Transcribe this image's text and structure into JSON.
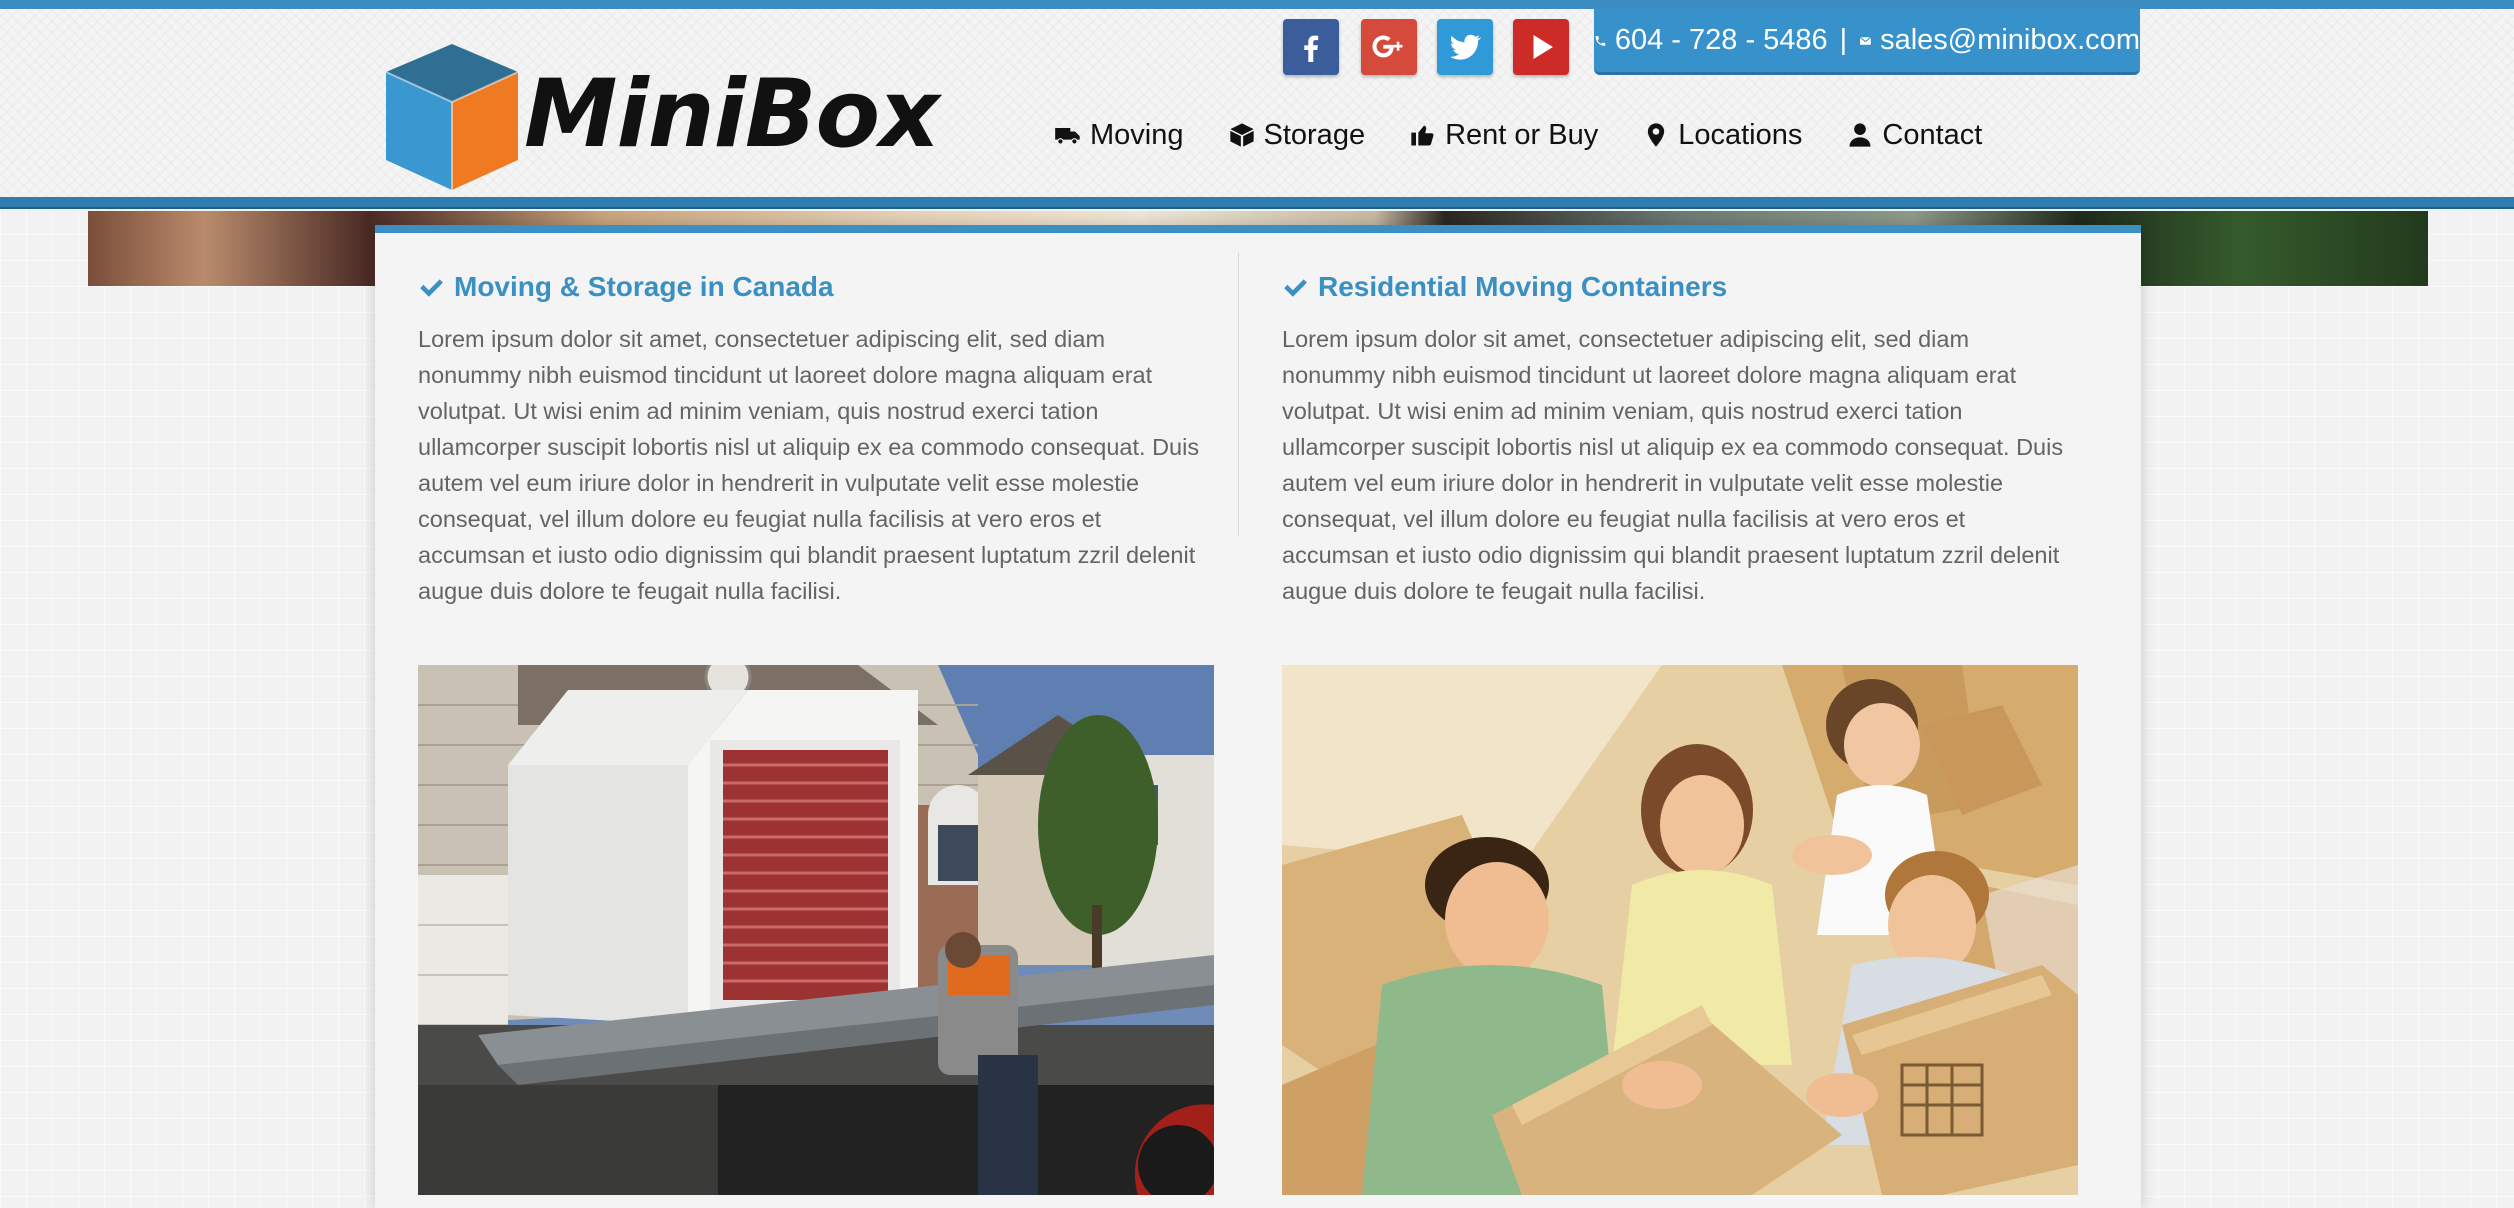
{
  "brand": {
    "name": "MiniBox"
  },
  "social": [
    {
      "name": "facebook-icon"
    },
    {
      "name": "google-plus-icon"
    },
    {
      "name": "twitter-icon"
    },
    {
      "name": "youtube-icon"
    }
  ],
  "contact": {
    "phone": "604 - 728 - 5486",
    "separator": "|",
    "email": "sales@minibox.com"
  },
  "nav": {
    "items": [
      {
        "label": "Moving",
        "icon": "truck-icon"
      },
      {
        "label": "Storage",
        "icon": "cube-icon"
      },
      {
        "label": "Rent or Buy",
        "icon": "thumbs-up-icon"
      },
      {
        "label": "Locations",
        "icon": "map-marker-icon"
      },
      {
        "label": "Contact",
        "icon": "user-icon"
      }
    ]
  },
  "sections": [
    {
      "title": "Moving & Storage in Canada",
      "body": "Lorem ipsum dolor sit amet, consectetuer adipiscing elit, sed diam nonummy nibh euismod tincidunt ut laoreet dolore magna aliquam erat volutpat. Ut wisi enim ad minim veniam, quis nostrud exerci tation ullamcorper suscipit lobortis nisl ut aliquip ex ea commodo consequat. Duis autem vel eum iriure dolor in hendrerit in vulputate velit esse molestie consequat, vel illum dolore eu feugiat nulla facilisis at vero eros et accumsan et iusto odio dignissim qui blandit praesent luptatum zzril delenit augue duis dolore te feugait nulla facilisi."
    },
    {
      "title": "Residential Moving Containers",
      "body": "Lorem ipsum dolor sit amet, consectetuer adipiscing elit, sed diam nonummy nibh euismod tincidunt ut laoreet dolore magna aliquam erat volutpat. Ut wisi enim ad minim veniam, quis nostrud exerci tation ullamcorper suscipit lobortis nisl ut aliquip ex ea commodo consequat. Duis autem vel eum iriure dolor in hendrerit in vulputate velit esse molestie consequat, vel illum dolore eu feugiat nulla facilisis at vero eros et accumsan et iusto odio dignissim qui blandit praesent luptatum zzril delenit augue duis dolore te feugait nulla facilisi."
    }
  ],
  "colors": {
    "accent": "#3b8fc2",
    "header_line": "#2d7eae",
    "text": "#646464"
  }
}
